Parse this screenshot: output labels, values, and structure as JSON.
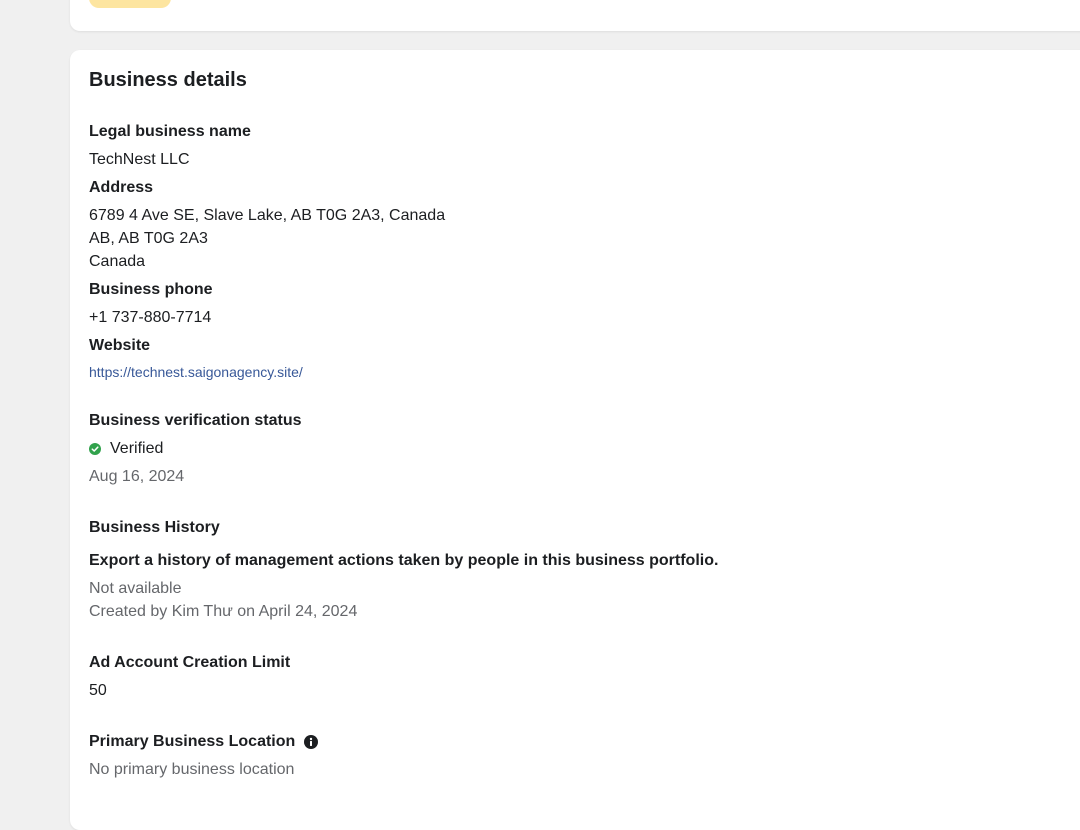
{
  "section": {
    "title": "Business details"
  },
  "legal_name": {
    "label": "Legal business name",
    "value": "TechNest LLC"
  },
  "address": {
    "label": "Address",
    "line1": "6789 4 Ave SE, Slave Lake, AB T0G 2A3, Canada",
    "line2": "AB, AB T0G 2A3",
    "line3": "Canada"
  },
  "phone": {
    "label": "Business phone",
    "value": "+1 737-880-7714"
  },
  "website": {
    "label": "Website",
    "url": "https://technest.saigonagency.site/"
  },
  "verification": {
    "label": "Business verification status",
    "status": "Verified",
    "date": "Aug 16, 2024",
    "status_color": "#31a24c",
    "icon": "check-circle-icon"
  },
  "history": {
    "label": "Business History",
    "description": "Export a history of management actions taken by people in this business portfolio.",
    "availability": "Not available",
    "created": "Created by Kim Thư on April 24, 2024"
  },
  "ad_limit": {
    "label": "Ad Account Creation Limit",
    "value": "50"
  },
  "primary_location": {
    "label": "Primary Business Location",
    "value": "No primary business location",
    "icon": "info-icon"
  },
  "colors": {
    "accent_button": "#fde5a0",
    "link": "#385898"
  }
}
